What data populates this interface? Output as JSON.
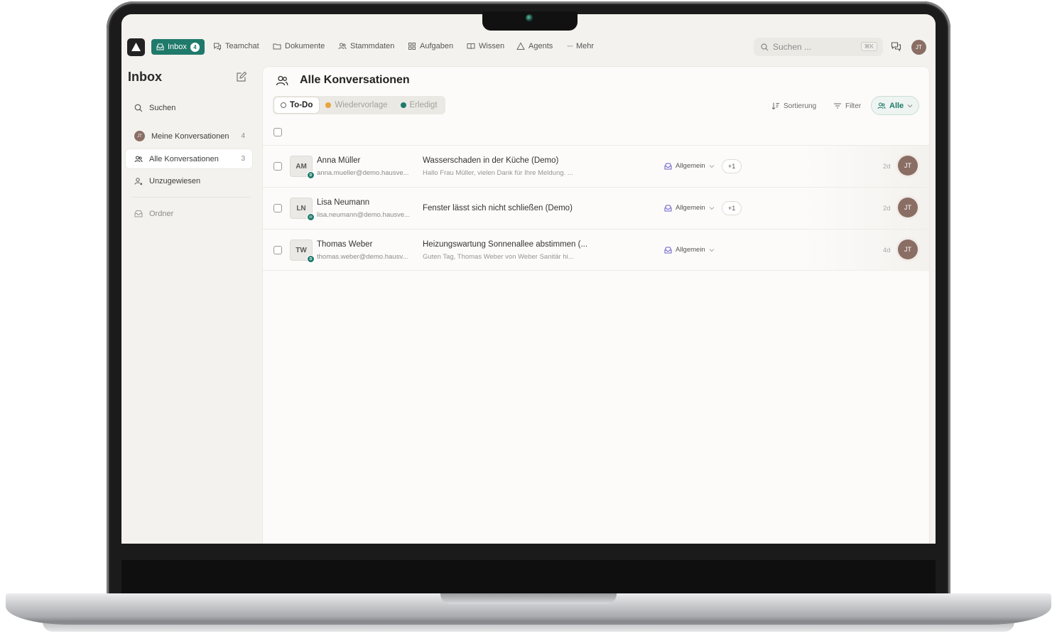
{
  "nav": {
    "inbox_label": "Inbox",
    "inbox_badge": "4",
    "items": [
      "Teamchat",
      "Dokumente",
      "Stammdaten",
      "Aufgaben",
      "Wissen",
      "Agents",
      "Mehr"
    ],
    "search_placeholder": "Suchen ...",
    "search_shortcut": "⌘K",
    "user_initials": "JT"
  },
  "sidebar": {
    "title": "Inbox",
    "search_label": "Suchen",
    "items": [
      {
        "label": "Meine Konversationen",
        "count": "4",
        "avatar": "JT"
      },
      {
        "label": "Alle Konversationen",
        "count": "3"
      },
      {
        "label": "Unzugewiesen"
      }
    ],
    "folder_label": "Ordner"
  },
  "main": {
    "title": "Alle Konversationen",
    "tabs": [
      {
        "label": "To-Do",
        "active": true
      },
      {
        "label": "Wiedervorlage",
        "color": "#e8a33d"
      },
      {
        "label": "Erledigt",
        "color": "#1f7a6b"
      }
    ],
    "sort_label": "Sortierung",
    "filter_label": "Filter",
    "scope_label": "Alle",
    "accent_color": "#1f7a6b"
  },
  "conversations": [
    {
      "initials": "AM",
      "name": "Anna Müller",
      "email": "anna.mueller@demo.hausve...",
      "subject": "Wasserschaden in der Küche (Demo)",
      "preview": "Hallo Frau Müller, vielen Dank für Ihre Meldung. ...",
      "tag": "Allgemein",
      "extra": "+1",
      "time": "2d",
      "assignee": "JT"
    },
    {
      "initials": "LN",
      "name": "Lisa Neumann",
      "email": "lisa.neumann@demo.hausve...",
      "subject": "Fenster lässt sich nicht schließen (Demo)",
      "preview": "",
      "tag": "Allgemein",
      "extra": "+1",
      "time": "2d",
      "assignee": "JT"
    },
    {
      "initials": "TW",
      "name": "Thomas Weber",
      "email": "thomas.weber@demo.hausv...",
      "subject": "Heizungswartung Sonnenallee abstimmen (...",
      "preview": "Guten Tag, Thomas Weber von Weber Sanitär hi...",
      "tag": "Allgemein",
      "extra": "",
      "time": "4d",
      "assignee": "JT"
    }
  ]
}
